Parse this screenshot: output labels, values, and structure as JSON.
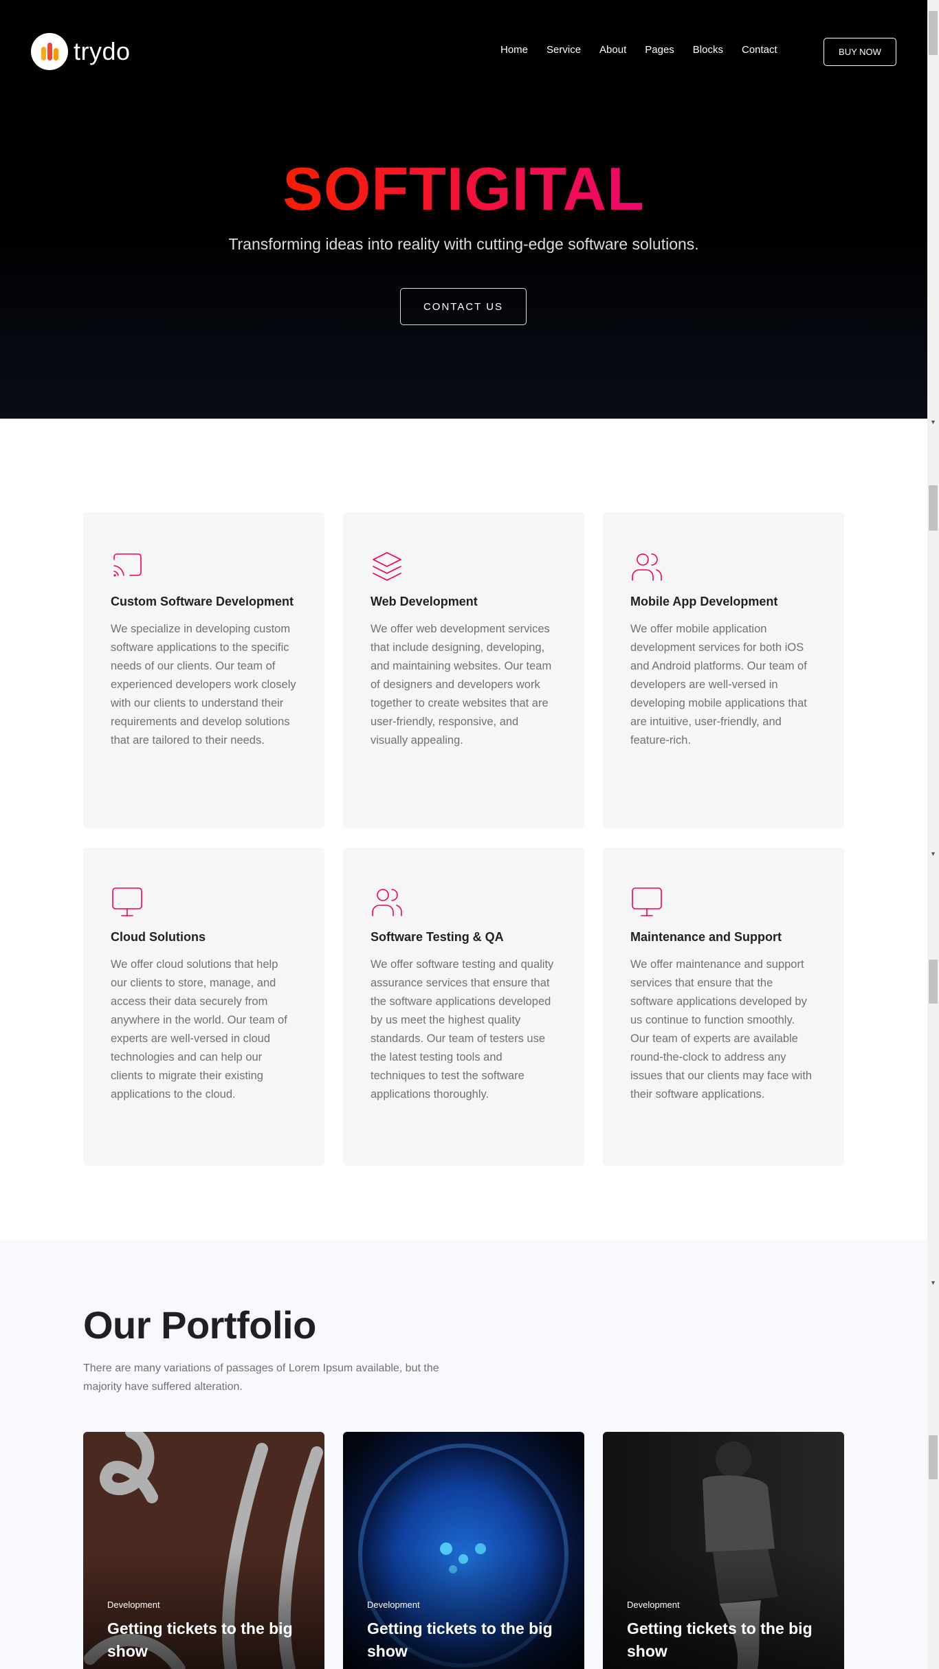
{
  "header": {
    "logo_text": "trydo",
    "nav": [
      "Home",
      "Service",
      "About",
      "Pages",
      "Blocks",
      "Contact"
    ],
    "buy_label": "BUY NOW"
  },
  "hero": {
    "title": "SOFTIGITAL",
    "subtitle": "Transforming ideas into reality with cutting-edge software solutions.",
    "cta_label": "CONTACT US",
    "gradient_colors": [
      "#f81f01",
      "#ee076e"
    ]
  },
  "services": [
    {
      "icon": "cast-icon",
      "title": "Custom Software Development",
      "description": "We specialize in developing custom software applications to the specific needs of our clients. Our team of experienced developers work closely with our clients to understand their requirements and develop solutions that are tailored to their needs."
    },
    {
      "icon": "layers-icon",
      "title": "Web Development",
      "description": "We offer web development services that include designing, developing, and maintaining websites. Our team of designers and developers work together to create websites that are user-friendly, responsive, and visually appealing."
    },
    {
      "icon": "users-icon",
      "title": "Mobile App Development",
      "description": "We offer mobile application development services for both iOS and Android platforms. Our team of developers are well-versed in developing mobile applications that are intuitive, user-friendly, and feature-rich."
    },
    {
      "icon": "monitor-icon",
      "title": "Cloud Solutions",
      "description": "We offer cloud solutions that help our clients to store, manage, and access their data securely from anywhere in the world. Our team of experts are well-versed in cloud technologies and can help our clients to migrate their existing applications to the cloud."
    },
    {
      "icon": "users-icon",
      "title": "Software Testing & QA",
      "description": "We offer software testing and quality assurance services that ensure that the software applications developed by us meet the highest quality standards. Our team of testers use the latest testing tools and techniques to test the software applications thoroughly."
    },
    {
      "icon": "monitor-icon",
      "title": "Maintenance and Support",
      "description": "We offer maintenance and support services that ensure that the software applications developed by us continue to function smoothly. Our team of experts are available round-the-clock to address any issues that our clients may face with their software applications."
    }
  ],
  "accent_color": "#f9004d",
  "portfolio": {
    "title": "Our Portfolio",
    "description": "There are many variations of passages of Lorem Ipsum available, but the majority have suffered alteration.",
    "items": [
      {
        "category": "Development",
        "title": "Getting tickets to the big show",
        "image": "brown-script-lettering"
      },
      {
        "category": "Development",
        "title": "Getting tickets to the big show",
        "image": "blue-jellyfish"
      },
      {
        "category": "Development",
        "title": "Getting tickets to the big show",
        "image": "monochrome-seated-figure"
      }
    ]
  }
}
